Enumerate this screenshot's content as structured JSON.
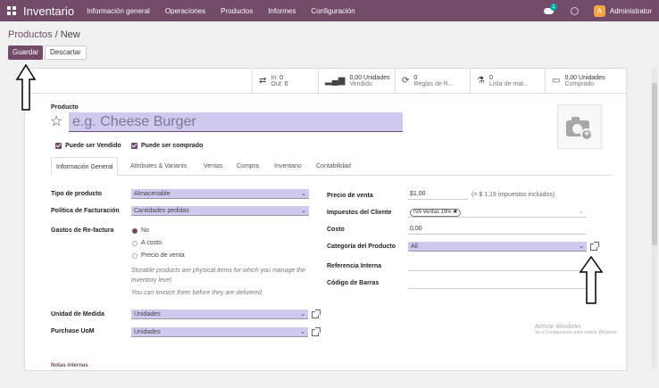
{
  "navbar": {
    "app_name": "Inventario",
    "menus": [
      "Información general",
      "Operaciones",
      "Productos",
      "Informes",
      "Configuración"
    ],
    "chat_badge": "1",
    "avatar_letter": "A",
    "user_name": "Administrator"
  },
  "breadcrumb": {
    "parent": "Productos",
    "separator": " / ",
    "current": "New"
  },
  "actions": {
    "save": "Guardar",
    "discard": "Descartar"
  },
  "smart_buttons": {
    "in_label": "In:",
    "in_value": "0",
    "out_label": "Out:",
    "out_value": "0",
    "sold_value": "0,00 Unidades",
    "sold_label": "Vendido",
    "reorder_value": "0",
    "reorder_label": "Reglas de R...",
    "pricelist_value": "0",
    "pricelist_label": "Lista de mat...",
    "purchased_value": "0,00 Unidades",
    "purchased_label": "Comprado"
  },
  "product": {
    "label": "Producto",
    "name_placeholder": "e.g. Cheese Burger",
    "can_be_sold": "Puede ser Vendido",
    "can_be_purchased": "Puede ser comprado"
  },
  "tabs": [
    "Información General",
    "Attributes & Variants",
    "Ventas",
    "Compra",
    "Inventario",
    "Contabilidad"
  ],
  "left_fields": {
    "product_type_label": "Tipo de producto",
    "product_type_value": "Almacenable",
    "invoice_policy_label": "Política de Facturación",
    "invoice_policy_value": "Cantidades pedidas",
    "reinvoice_label": "Gastos de Re-factura",
    "reinvoice_options": [
      "No",
      "A costo",
      "Precio de venta"
    ],
    "help_1": "Storable products are physical items for which you manage the inventory level.",
    "help_2": "You can invoice them before they are delivered.",
    "uom_label": "Unidad de Medida",
    "uom_value": "Unidades",
    "purchase_uom_label": "Purchase UoM",
    "purchase_uom_value": "Unidades",
    "notes_label": "Notas internas"
  },
  "right_fields": {
    "sale_price_label": "Precio de venta",
    "sale_price_value": "$1,00",
    "sale_price_note": "(= $ 1,19 impuestos incluidos)",
    "customer_taxes_label": "Impuestos del Cliente",
    "customer_taxes_tag": "IVA Ventas 19%",
    "cost_label": "Costo",
    "cost_value": "0,00",
    "category_label": "Categoría del Producto",
    "category_value": "All",
    "internal_ref_label": "Referencia Interna",
    "barcode_label": "Código de Barras"
  },
  "watermark": {
    "title": "Activar Windows",
    "subtitle": "Ve a Configuración para activar Windows."
  }
}
